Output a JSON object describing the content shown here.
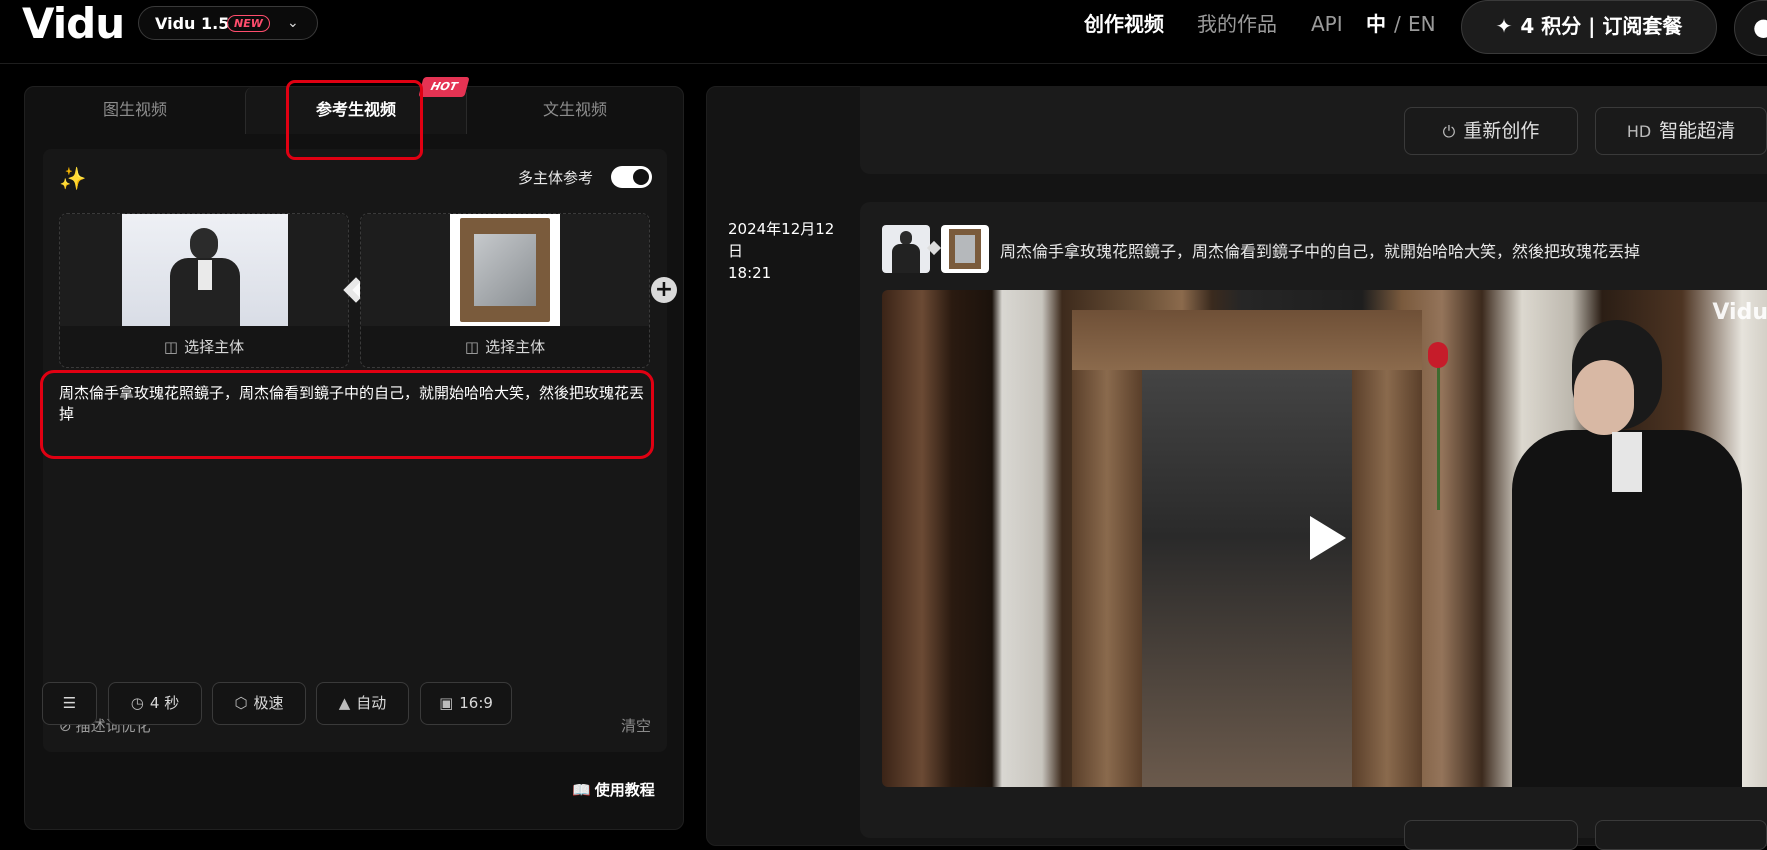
{
  "header": {
    "logo": "Vidu",
    "version": {
      "name": "Vidu 1.5",
      "badge": "NEW"
    },
    "nav": [
      {
        "label": "创作视频",
        "active": true
      },
      {
        "label": "我的作品",
        "active": false
      },
      {
        "label": "API",
        "active": false
      }
    ],
    "lang": {
      "zh": "中",
      "sep": "/",
      "en": "EN"
    },
    "subscribe_label": "4 积分 | 订阅套餐"
  },
  "left": {
    "tabs": [
      "图生视频",
      "参考生视频",
      "文生视频"
    ],
    "hot_badge": "HOT",
    "multi_subject_label": "多主体参考",
    "select_subject": "选择主体",
    "prompt": "周杰倫手拿玫瑰花照鏡子，周杰倫看到鏡子中的自己，就開始哈哈大笑，然後把玫瑰花丟掉",
    "optimize_label": "描述词优化",
    "clear_label": "清空",
    "controls": {
      "duration": "4 秒",
      "speed": "极速",
      "auto": "自动",
      "ratio": "16:9"
    },
    "tutorial": "使用教程"
  },
  "right": {
    "recreate_label": "重新创作",
    "upscale_label": "智能超清",
    "date_line1": "2024年12月12日",
    "date_line2": "18:21",
    "prompt": "周杰倫手拿玫瑰花照鏡子，周杰倫看到鏡子中的自己，就開始哈哈大笑，然後把玫瑰花丟掉",
    "watermark": "Vidu"
  },
  "colors": {
    "highlight": "#e00012",
    "hot": "#e53353",
    "new_badge": "#ff4d6d"
  }
}
